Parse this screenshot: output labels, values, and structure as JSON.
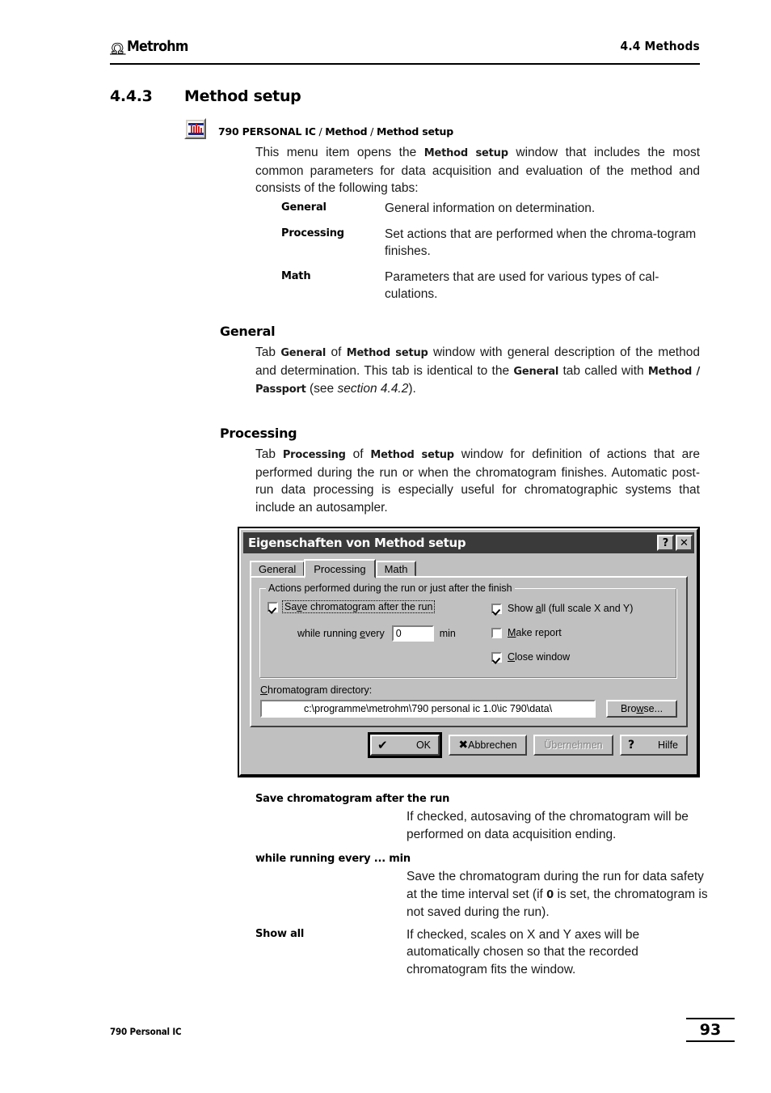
{
  "header": {
    "logo_text": "Metrohm",
    "logo_mark_icon": "metrohm-omega-icon",
    "right_title": "4.4  Methods"
  },
  "section": {
    "number": "4.4.3",
    "title": "Method setup"
  },
  "menu_block": {
    "icon": "method-setup-toolbar-icon",
    "path_app": "790 PERSONAL IC",
    "sep1": " / ",
    "path_menu": "Method",
    "sep2": " / ",
    "path_item": "Method setup",
    "intro_1": "This menu item opens the ",
    "intro_bold": "Method setup",
    "intro_2": " window that includes the most common parameters for data acquisition and evaluation of the method and consists of the following tabs:"
  },
  "tab_definitions": [
    {
      "term": "General",
      "desc": "General information on determination."
    },
    {
      "term": "Processing",
      "desc": "Set actions that are performed when the chroma-togram finishes."
    },
    {
      "term": "Math",
      "desc": "Parameters that are used for various types of cal-culations."
    }
  ],
  "general_section": {
    "heading": "General",
    "t1": "Tab ",
    "b1": "General",
    "t2": " of ",
    "b2": "Method setup",
    "t3": " window with general description of the method and determination. This tab is identical to the ",
    "b3": "General",
    "t4": " tab called with ",
    "b4": "Method",
    "t5": " / ",
    "b5": "Passport",
    "t6": " (see ",
    "i1": "section 4.4.2",
    "t7": ")."
  },
  "processing_section": {
    "heading": "Processing",
    "t1": "Tab ",
    "b1": "Processing",
    "t2": " of ",
    "b2": "Method setup",
    "t3": " window for definition of actions that are performed during the run or when the chromatogram finishes. Automatic post-run data processing is especially useful for chromatographic systems that include an autosampler."
  },
  "dialog": {
    "title": "Eigenschaften von Method setup",
    "help_button_label": "?",
    "close_button_label": "✕",
    "tabs": [
      {
        "label": "General",
        "active": false
      },
      {
        "label": "Processing",
        "active": true
      },
      {
        "label": "Math",
        "active": false
      }
    ],
    "groupbox_legend": "Actions performed during the run or just after the finish",
    "checkbox_save": {
      "label_pre": "Sa",
      "label_mnemonic": "v",
      "label_post": "e chromatogram after the run",
      "checked": true,
      "focused": true
    },
    "interval": {
      "label_pre": "while running ",
      "label_mnemonic": "e",
      "label_post": "very",
      "value": "0",
      "unit": "min"
    },
    "checkbox_showall": {
      "label_pre": "Show ",
      "label_mnemonic": "a",
      "label_post": "ll (full scale X and Y)",
      "checked": true
    },
    "checkbox_report": {
      "label_pre": "",
      "label_mnemonic": "M",
      "label_post": "ake report",
      "checked": false
    },
    "checkbox_close": {
      "label_pre": "",
      "label_mnemonic": "C",
      "label_post": "lose window",
      "checked": true
    },
    "directory": {
      "label_pre": "",
      "label_mnemonic": "C",
      "label_post": "hromatogram directory:",
      "value": "c:\\programme\\metrohm\\790 personal ic 1.0\\ic 790\\data\\",
      "browse_pre": "Bro",
      "browse_mnemonic": "w",
      "browse_post": "se..."
    },
    "buttons": {
      "ok_glyph": "✔",
      "ok": "OK",
      "cancel_glyph": "✖",
      "cancel": "Abbrechen",
      "apply": "Übernehmen",
      "help_glyph": "?",
      "help": "Hilfe"
    }
  },
  "term_definitions": [
    {
      "term": "Save chromatogram after the run",
      "desc": "If checked, autosaving of the chromatogram will be performed on data acquisition ending."
    },
    {
      "term": "while running every ... min",
      "desc_1": "Save the chromatogram during the run for data safety at the time interval set (if ",
      "desc_bold": "0",
      "desc_2": " is set, the chromatogram is not saved during the run)."
    },
    {
      "term": "Show all",
      "desc": "If checked, scales on X and Y axes will be automatically chosen so that the recorded chromatogram fits the window."
    }
  ],
  "footer": {
    "left": "790 Personal IC",
    "page": "93"
  }
}
